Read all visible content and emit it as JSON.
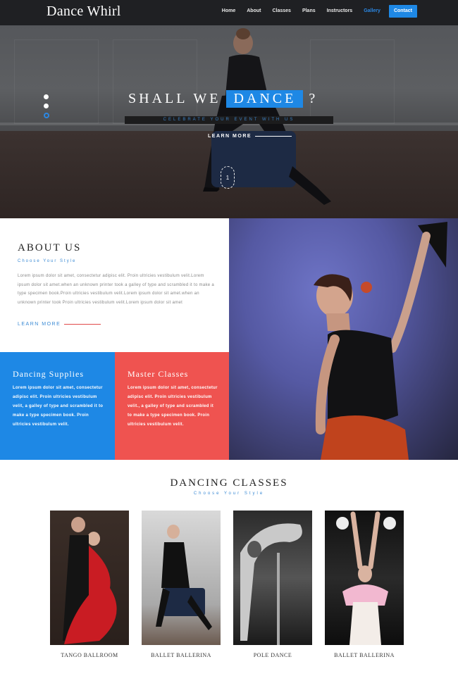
{
  "header": {
    "logo": "Dance Whirl",
    "nav": [
      "Home",
      "About",
      "Classes",
      "Plans",
      "Instructors",
      "Gallery",
      "Contact"
    ],
    "active_nav": "Gallery",
    "accent": "#1e88e5"
  },
  "hero": {
    "title_before": "SHALL WE",
    "title_highlight": "DANCE",
    "title_after": "?",
    "subtitle": "CELEBRATE YOUR EVENT WITH US",
    "learn_more": "LEARN MORE",
    "scroll_indicator": "1",
    "slide_count": 3,
    "active_slide": 3
  },
  "about": {
    "title": "ABOUT US",
    "subtitle": "Choose Your Style",
    "text": "Lorem ipsum dolor sit amet, consectetur adipisc elit. Proin ultricies vestibulum velit.Lorem ipsum dolor sit amet.when an unknown printer took a galley of type and scrambled it to make a type specimen book.Proin ultricies vestibulum velit.Lorem ipsum dolor sit amet.when an unknown printer took Proin ultricies vestibulum velit.Lorem ipsum dolor sit amet",
    "learn_more": "LEARN MORE"
  },
  "features": [
    {
      "title": "Dancing Supplies",
      "text": "Lorem ipsum dolor sit amet, consectetur adipisc elit. Proin ultricies vestibulum velit, a galley of type and scrambled it to make a type specimen book. Proin ultricies vestibulum velit.",
      "color": "#1e88e5"
    },
    {
      "title": "Master Classes",
      "text": "Lorem ipsum dolor sit amet, consectetur adipisc elit. Proin ultricies vestibulum velit., a galley of type and scrambled it to make a type specimen book. Proin ultricies vestibulum velit.",
      "color": "#ef5350"
    }
  ],
  "classes": {
    "title": "DANCING CLASSES",
    "subtitle": "Choose Your Style",
    "items": [
      {
        "caption": "TANGO BALLROOM"
      },
      {
        "caption": "BALLET BALLERINA"
      },
      {
        "caption": "POLE DANCE"
      },
      {
        "caption": "BALLET BALLERINA"
      }
    ]
  }
}
